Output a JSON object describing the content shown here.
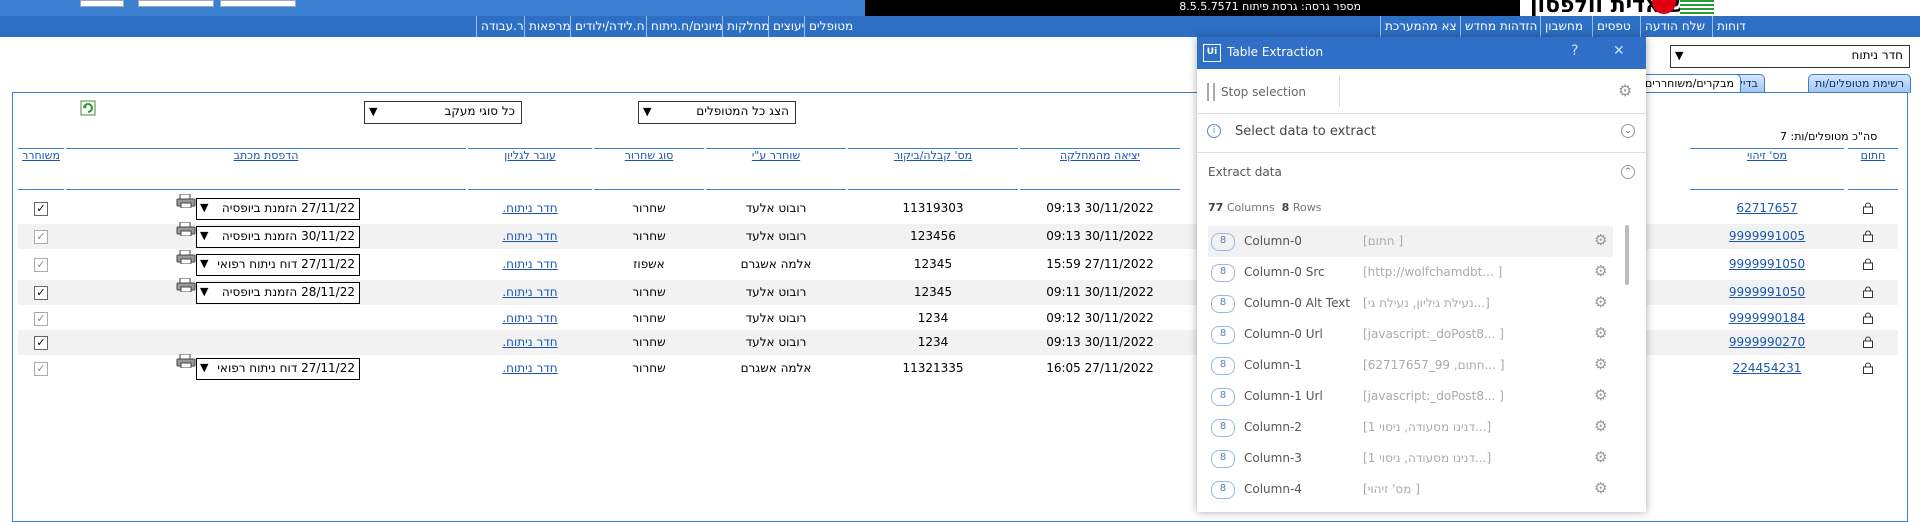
{
  "header": {
    "version_text": "מספר גרסה: גרסת פיתוח 8.5.5.7571",
    "logo_text": "עיש אדית וולפסון"
  },
  "nav": {
    "items": [
      "דוחות",
      "שלח הודעה",
      "טפסים",
      "מחשבון",
      "הזדהות מחדש",
      "צא מהמערכת",
      "מטופלים",
      "יעוצים",
      "מחלקות",
      "מיונים/ח.ניתוח",
      "ח.לידה/ילודים",
      "מרפאות",
      "ר.עבודה"
    ]
  },
  "room_select": {
    "value": "חדר ניתוח"
  },
  "tabs": [
    "רשימת מטופלים/ות",
    "בדיקות",
    "מבקרים/משוחררים"
  ],
  "filters": {
    "patients_select": "הצג כל המטופלים",
    "followup_select": "כל סוגי מעקב"
  },
  "count_text": "סה\"כ מטופלים/ות: 7",
  "table": {
    "headers": {
      "locked": "חתום",
      "id": "מס' זיהוי",
      "exit": "יציאה מהמחלקה",
      "admission": "מס' קבלה/ביקור",
      "released_by": "שוחרר ע\"י",
      "release_type": "סוג שחרור",
      "transferred": "עובר לגליון",
      "print_letter": "הדפסת מכתב",
      "released": "משוחרר"
    },
    "rows": [
      {
        "id": "62717657",
        "exit": "30/11/2022 09:13",
        "admission": "11319303",
        "released_by": "רובוט אלעד",
        "release_type": "שחרור",
        "transferred": "חדר ניתוח.",
        "print": "27/11/22 הזמנת ביופסיה",
        "checked": true,
        "dim": false
      },
      {
        "id": "9999991005",
        "exit": "30/11/2022 09:13",
        "admission": "123456",
        "released_by": "רובוט אלעד",
        "release_type": "שחרור",
        "transferred": "חדר ניתוח.",
        "print": "30/11/22 הזמנת ביופסיה",
        "checked": true,
        "dim": true
      },
      {
        "id": "9999991050",
        "exit": "27/11/2022 15:59",
        "admission": "12345",
        "released_by": "אלמה אשגרם",
        "release_type": "אשפוז",
        "transferred": "חדר ניתוח.",
        "print": "27/11/22 דוח ניתוח רפואי",
        "checked": true,
        "dim": true
      },
      {
        "id": "9999991050",
        "exit": "30/11/2022 09:11",
        "admission": "12345",
        "released_by": "רובוט אלעד",
        "release_type": "שחרור",
        "transferred": "חדר ניתוח.",
        "print": "28/11/22 הזמנת ביופסיה",
        "checked": true,
        "dim": false
      },
      {
        "id": "9999990184",
        "exit": "30/11/2022 09:12",
        "admission": "1234",
        "released_by": "רובוט אלעד",
        "release_type": "שחרור",
        "transferred": "חדר ניתוח.",
        "print": "",
        "checked": true,
        "dim": true
      },
      {
        "id": "9999990270",
        "exit": "30/11/2022 09:13",
        "admission": "1234",
        "released_by": "רובוט אלעד",
        "release_type": "שחרור",
        "transferred": "חדר ניתוח.",
        "print": "",
        "checked": true,
        "dim": false
      },
      {
        "id": "224454231",
        "exit": "27/11/2022 16:05",
        "admission": "11321335",
        "released_by": "אלמה אשגרם",
        "release_type": "שחרור",
        "transferred": "חדר ניתוח.",
        "print": "27/11/22 דוח ניתוח רפואי",
        "checked": true,
        "dim": true
      }
    ]
  },
  "dialog": {
    "title": "Table Extraction",
    "help": "?",
    "close": "✕",
    "logo": "Ui",
    "stop_selection": "Stop selection",
    "select_data": "Select data to extract",
    "extract_data": "Extract data",
    "columns_count": "77",
    "columns_label": "Columns",
    "rows_count": "8",
    "rows_label": "Rows",
    "columns": [
      {
        "badge": "8",
        "name": "Column-0",
        "value": "[חתום                  ]"
      },
      {
        "badge": "8",
        "name": "Column-0 Src",
        "value": "[http://wolfchamdbt...   ]"
      },
      {
        "badge": "8",
        "name": "Column-0 Alt Text",
        "value": "[נעילת גיליון, נעילת גי...]"
      },
      {
        "badge": "8",
        "name": "Column-0 Url",
        "value": "[javascript:_doPost8...  ]"
      },
      {
        "badge": "8",
        "name": "Column-1",
        "value": "[חתום, 99_62717657...    ]"
      },
      {
        "badge": "8",
        "name": "Column-1 Url",
        "value": "[javascript:_doPost8...  ]"
      },
      {
        "badge": "8",
        "name": "Column-2",
        "value": "[דנינו מסעודה, ניסוי 1...]"
      },
      {
        "badge": "8",
        "name": "Column-3",
        "value": "[דנינו מסעודה, ניסוי 1...]"
      },
      {
        "badge": "8",
        "name": "Column-4",
        "value": "[מס' זיהוי              ]"
      }
    ]
  }
}
